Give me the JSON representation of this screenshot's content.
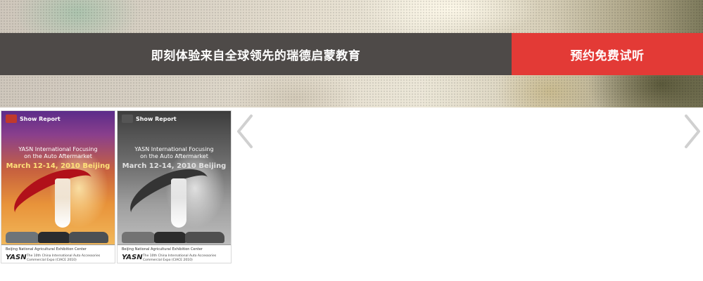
{
  "banner": {
    "headline": "即刻体验来自全球领先的瑞德启蒙教育",
    "cta_button": "预约免费试听",
    "colors": {
      "bar": "#4e4a48",
      "cta": "#e33a36"
    }
  },
  "gallery": {
    "thumbnails": [
      {
        "label": "Show Report",
        "title_line1": "YASN International Focusing",
        "title_line2": "on the Auto Aftermarket",
        "date": "March 12-14, 2010 Beijing",
        "venue": "Beijing National Agricultural Exhibition Center",
        "brand": "YASN",
        "expo": "The 10th China International Auto Accessories Commercial Expo (CIACE 2010)",
        "style": "color"
      },
      {
        "label": "Show Report",
        "title_line1": "YASN International Focusing",
        "title_line2": "on the Auto Aftermarket",
        "date": "March 12-14, 2010 Beijing",
        "venue": "Beijing National Agricultural Exhibition Center",
        "brand": "YASN",
        "expo": "The 10th China International Auto Accessories Commercial Expo (CIACE 2010)",
        "style": "grayscale"
      }
    ],
    "prev_icon": "chevron-left-icon",
    "next_icon": "chevron-right-icon"
  }
}
